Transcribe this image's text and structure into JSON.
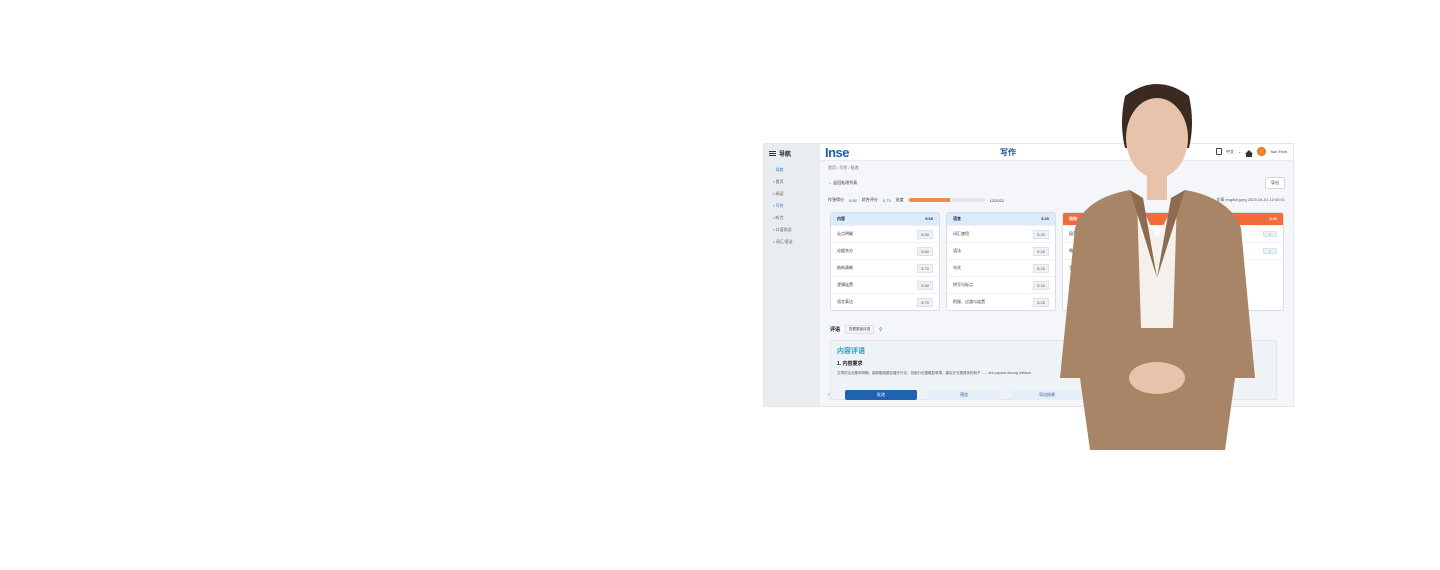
{
  "sidebar": {
    "title": "导航",
    "items": [
      {
        "label": "· 导航"
      },
      {
        "label": "• 首页"
      },
      {
        "label": "• 阅读"
      },
      {
        "label": "• 写作"
      },
      {
        "label": "• 听力"
      },
      {
        "label": "• 口语测试"
      },
      {
        "label": "• 词汇/语法"
      }
    ]
  },
  "topbar": {
    "logo": "Inse",
    "heading": "写作",
    "language": "中文",
    "brand": "Sun Tech"
  },
  "main": {
    "breadcrumb": "首页 / 写作 / 批改",
    "back_label": "← 返回批改列表",
    "export_label": "导出",
    "meta": {
      "score_label": "作答得分",
      "score_link": "5.65",
      "overall_label": "综合评分",
      "overall_link": "5.73",
      "progress_label": "进度",
      "progress_value": 0.55,
      "progress_text": "12/2021",
      "file_info": "文章 english.jpeg 2025-04-01 12:00:01"
    },
    "cards": [
      {
        "title": "内容",
        "score": "5.60",
        "header_color": "#dcebfb",
        "rows": [
          {
            "label": "论点明确",
            "value": "5.80"
          },
          {
            "label": "论据充分",
            "value": "5.60"
          },
          {
            "label": "结构清晰",
            "value": "5.70"
          },
          {
            "label": "逻辑连贯",
            "value": "5.60"
          },
          {
            "label": "语言表达",
            "value": "5.70"
          }
        ]
      },
      {
        "title": "语言",
        "score": "5.20",
        "header_color": "#dcebfb",
        "rows": [
          {
            "label": "词汇使用",
            "value": "5.20"
          },
          {
            "label": "语法",
            "value": "5.20"
          },
          {
            "label": "句式",
            "value": "5.20"
          },
          {
            "label": "拼写与标点",
            "value": "5.10"
          },
          {
            "label": "衔接、过渡与连贯",
            "value": "5.20"
          }
        ]
      },
      {
        "title": "结构",
        "score": "5.20",
        "header_color": "#f26b3a",
        "rows": [
          {
            "label": "段落结构",
            "tick": "✓"
          },
          {
            "label": "格式",
            "tick": "✓"
          },
          {
            "label": "字数",
            "tick": ""
          }
        ]
      }
    ],
    "review": {
      "label": "评语",
      "tag": "查看原始评语",
      "title": "内容评语",
      "subtitle": "1. 内容要求",
      "text": "文章的论点基本明确，能够围绕题目展开讨论，但部分论据略显单薄，建议补充更具体的例子…… are popular among children."
    },
    "actions": [
      {
        "label": "批改"
      },
      {
        "label": "预览"
      },
      {
        "label": "导出结果"
      }
    ]
  },
  "presenter": {
    "colors": {
      "blazer": "#a88566",
      "blazer_shadow": "#8c6b50",
      "blouse": "#f4f1ec",
      "hair": "#3b2a20",
      "skin": "#e8c3ab"
    }
  }
}
